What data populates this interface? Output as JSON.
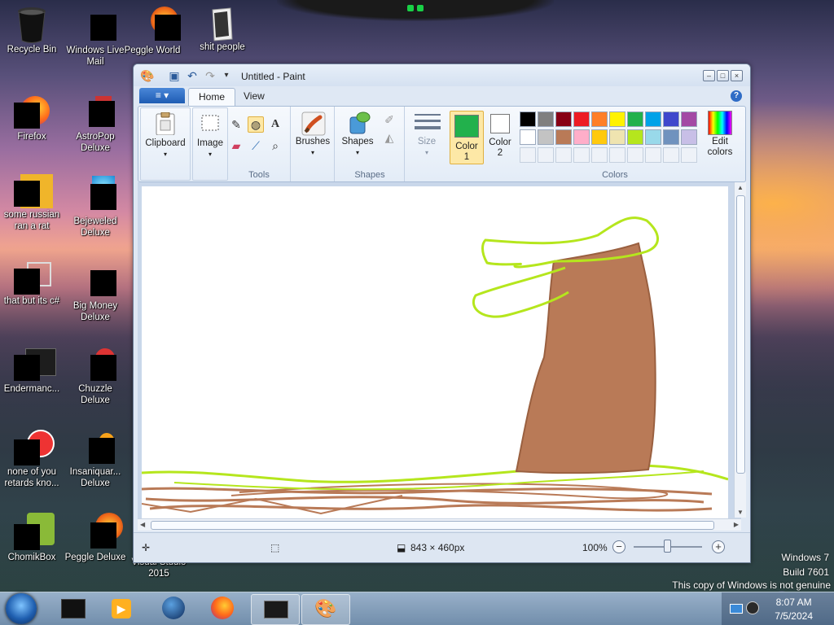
{
  "desktop": {
    "icons": [
      {
        "label": "Recycle Bin",
        "icon": "recycle-bin-icon"
      },
      {
        "label": "Windows Live Mail",
        "icon": "mail-icon"
      },
      {
        "label": "Peggle World",
        "icon": "peggle-icon"
      },
      {
        "label": "shit people",
        "icon": "folder-icon"
      },
      {
        "label": "Firefox",
        "icon": "firefox-icon"
      },
      {
        "label": "AstroPop Deluxe",
        "icon": "game-icon"
      },
      {
        "label": "some russian ran a rat",
        "icon": "app-icon"
      },
      {
        "label": "Bejeweled Deluxe",
        "icon": "game-icon"
      },
      {
        "label": "that but its c#",
        "icon": "app-icon"
      },
      {
        "label": "Big Money Deluxe",
        "icon": "game-icon"
      },
      {
        "label": "Endermanc...",
        "icon": "app-icon"
      },
      {
        "label": "Chuzzle Deluxe",
        "icon": "game-icon"
      },
      {
        "label": "none of you retards kno...",
        "icon": "app-icon"
      },
      {
        "label": "Insaniquar... Deluxe",
        "icon": "game-icon"
      },
      {
        "label": "ChomikBox",
        "icon": "chomikbox-icon"
      },
      {
        "label": "Peggle Deluxe",
        "icon": "peggle-icon"
      },
      {
        "label": "Visual Studio 2015",
        "icon": "visual-studio-icon"
      }
    ]
  },
  "paint": {
    "title": "Untitled - Paint",
    "file_tab": "≡ ▾",
    "tabs": [
      "Home",
      "View"
    ],
    "ribbon": {
      "clipboard": "Clipboard",
      "image": "Image",
      "tools_label": "Tools",
      "brushes": "Brushes",
      "shapes": "Shapes",
      "shapes_label": "Shapes",
      "size": "Size",
      "color1": "Color 1",
      "color2": "Color 2",
      "colors_label": "Colors",
      "edit_colors": "Edit colors"
    },
    "color1_value": "#22b14c",
    "color2_value": "#ffffff",
    "palette_row1": [
      "#000000",
      "#7f7f7f",
      "#880015",
      "#ed1c24",
      "#ff7f27",
      "#fff200",
      "#22b14c",
      "#00a2e8",
      "#3f48cc",
      "#a349a4"
    ],
    "palette_row2": [
      "#ffffff",
      "#c3c3c3",
      "#b97a57",
      "#ffaec9",
      "#ffc90e",
      "#efe4b0",
      "#b5e61d",
      "#99d9ea",
      "#7092be",
      "#c8bfe7"
    ],
    "status": {
      "canvas_size": "843 × 460px",
      "zoom": "100%"
    }
  },
  "watermark": {
    "line1": "Windows 7",
    "line2": "Build 7601",
    "line3": "This copy of Windows is not genuine"
  },
  "taskbar": {
    "time": "8:07 AM",
    "date": "7/5/2024"
  }
}
